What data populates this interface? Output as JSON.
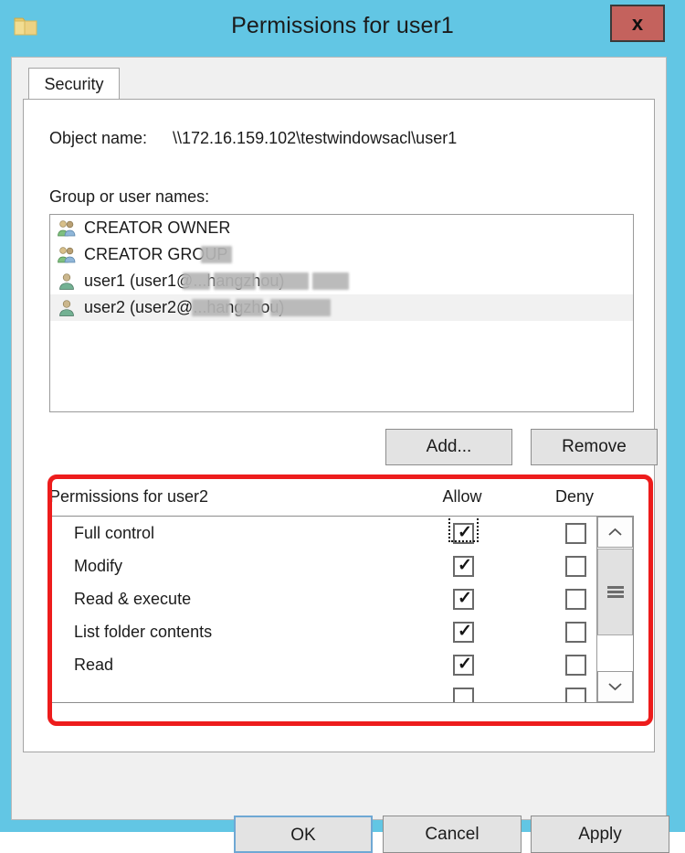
{
  "window": {
    "title": "Permissions for user1",
    "icon": "folder-icon",
    "close_label": "x",
    "titlebar_color": "#62c6e4",
    "close_color": "#c4625d"
  },
  "tabs": [
    {
      "label": "Security",
      "active": true
    }
  ],
  "object": {
    "label": "Object name:",
    "value": "\\\\172.16.159.102\\testwindowsacl\\user1"
  },
  "groups": {
    "label": "Group or user names:",
    "items": [
      {
        "name": "CREATOR OWNER",
        "icon": "group-icon",
        "selected": false,
        "redacted": false
      },
      {
        "name": "CREATOR GROUP",
        "icon": "group-icon",
        "selected": false,
        "redacted": true
      },
      {
        "name": "user1 (user1@...hangzhou)",
        "icon": "user-icon",
        "selected": false,
        "redacted": true
      },
      {
        "name": "user2 (user2@...hangzhou)",
        "icon": "user-icon",
        "selected": true,
        "redacted": true
      }
    ]
  },
  "list_buttons": {
    "add_label": "Add...",
    "remove_label": "Remove"
  },
  "permissions": {
    "header_label": "Permissions for user2",
    "allow_header": "Allow",
    "deny_header": "Deny",
    "focused_row": 0,
    "rows": [
      {
        "name": "Full control",
        "allow": true,
        "deny": false
      },
      {
        "name": "Modify",
        "allow": true,
        "deny": false
      },
      {
        "name": "Read & execute",
        "allow": true,
        "deny": false
      },
      {
        "name": "List folder contents",
        "allow": true,
        "deny": false
      },
      {
        "name": "Read",
        "allow": true,
        "deny": false
      },
      {
        "name": "",
        "allow": false,
        "deny": false
      }
    ],
    "scrollbar": {
      "up_label": "⌃",
      "down_label": "⌄"
    }
  },
  "annotation": {
    "color": "#ed1c1c"
  },
  "footer": {
    "ok_label": "OK",
    "cancel_label": "Cancel",
    "apply_label": "Apply"
  }
}
